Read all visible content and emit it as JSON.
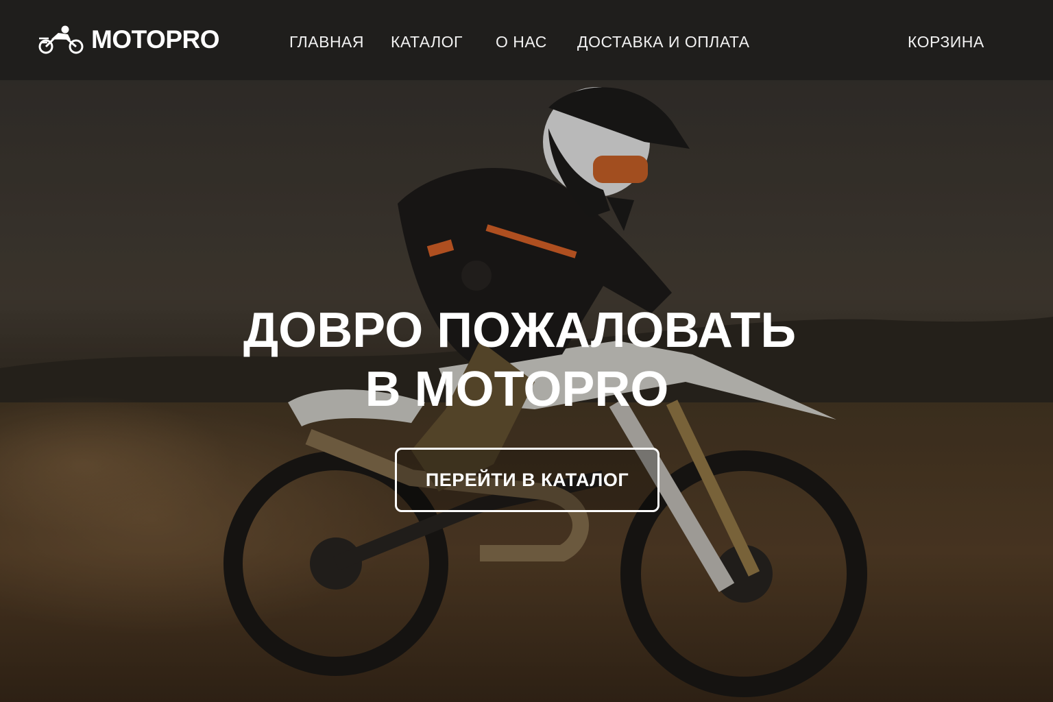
{
  "brand": {
    "name": "MOTOPRO",
    "logo_icon": "motorcycle-rider-icon"
  },
  "nav": {
    "home": "ГЛАВНАЯ",
    "catalog": "КАТАЛОГ",
    "about": "О НАС",
    "delivery": "ДОСТАВКА И ОПЛАТА",
    "cart": "КОРЗИНА"
  },
  "hero": {
    "title_line1": "ДОВРО ПОЖАЛОВАТЬ",
    "title_line2": "В MOTOPRO",
    "cta_label": "ПЕРЕЙТИ В КАТАЛОГ",
    "background": "dirt-bike-rider-photo"
  },
  "colors": {
    "navbar": "#1f1e1c",
    "text": "#ffffff",
    "accent": "#e0662a"
  }
}
